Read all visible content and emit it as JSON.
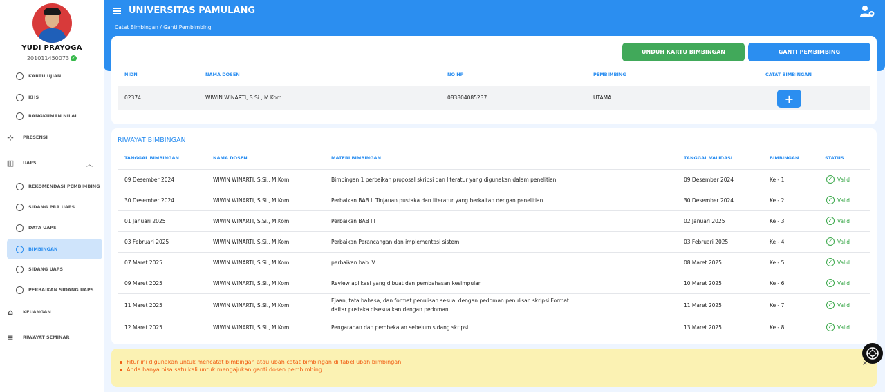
{
  "app": {
    "title": "UNIVERSITAS PAMULANG",
    "breadcrumb": "Catat Bimbingan / Ganti Pembimbing"
  },
  "user": {
    "name": "YUDI PRAYOGA",
    "nim": "201011450073"
  },
  "sidebar": {
    "items": [
      {
        "label": "KARTU UJIAN",
        "type": "sub"
      },
      {
        "label": "KHS",
        "type": "sub"
      },
      {
        "label": "RANGKUMAN NILAI",
        "type": "sub"
      },
      {
        "label": "PRESENSI",
        "type": "top",
        "icon": "fingerprint-icon"
      },
      {
        "label": "UAPS",
        "type": "top",
        "icon": "book-icon"
      },
      {
        "label": "REKOMENDASI PEMBIMBING",
        "type": "sub"
      },
      {
        "label": "SIDANG PRA UAPS",
        "type": "sub"
      },
      {
        "label": "DATA UAPS",
        "type": "sub"
      },
      {
        "label": "BIMBINGAN",
        "type": "sub",
        "active": true
      },
      {
        "label": "SIDANG UAPS",
        "type": "sub"
      },
      {
        "label": "PERBAIKAN SIDANG UAPS",
        "type": "sub"
      },
      {
        "label": "KEUANGAN",
        "type": "top",
        "icon": "bank-icon"
      },
      {
        "label": "RIWAYAT SEMINAR",
        "type": "top",
        "icon": "list-search-icon"
      }
    ]
  },
  "actions": {
    "download": "UNDUH KARTU BIMBINGAN",
    "change": "GANTI PEMBIMBING",
    "add": "+"
  },
  "advisor_table": {
    "headers": [
      "NIDN",
      "NAMA DOSEN",
      "NO HP",
      "PEMBIMBING",
      "CATAT BIMBINGAN"
    ],
    "row": {
      "nidn": "02374",
      "name": "WIWIN WINARTI, S.Si., M.Kom.",
      "phone": "083804085237",
      "role": "UTAMA"
    }
  },
  "history": {
    "title": "RIWAYAT BIMBINGAN",
    "headers": [
      "TANGGAL BIMBINGAN",
      "NAMA DOSEN",
      "MATERI BIMBINGAN",
      "TANGGAL VALIDASI",
      "BIMBINGAN",
      "STATUS"
    ],
    "rows": [
      {
        "date": "09 Desember 2024",
        "lecturer": "WIWIN WINARTI, S.Si., M.Kom.",
        "topic": "Bimbingan 1 perbaikan proposal skripsi dan literatur yang digunakan dalam penelitian",
        "topic2": "",
        "validated": "09 Desember 2024",
        "session": "Ke - 1",
        "status": "Valid"
      },
      {
        "date": "30 Desember 2024",
        "lecturer": "WIWIN WINARTI, S.Si., M.Kom.",
        "topic": "Perbaikan BAB II Tinjauan pustaka dan literatur yang berkaitan dengan penelitian",
        "topic2": "",
        "validated": "30 Desember 2024",
        "session": "Ke - 2",
        "status": "Valid"
      },
      {
        "date": "01 Januari 2025",
        "lecturer": "WIWIN WINARTI, S.Si., M.Kom.",
        "topic": "Perbaikan BAB III",
        "topic2": "",
        "validated": "02 Januari 2025",
        "session": "Ke - 3",
        "status": "Valid"
      },
      {
        "date": "03 Februari 2025",
        "lecturer": "WIWIN WINARTI, S.Si., M.Kom.",
        "topic": "Perbaikan Perancangan dan implementasi sistem",
        "topic2": "",
        "validated": "03 Februari 2025",
        "session": "Ke - 4",
        "status": "Valid"
      },
      {
        "date": "07 Maret 2025",
        "lecturer": "WIWIN WINARTI, S.Si., M.Kom.",
        "topic": "perbaikan bab IV",
        "topic2": "",
        "validated": "08 Maret 2025",
        "session": "Ke - 5",
        "status": "Valid"
      },
      {
        "date": "09 Maret 2025",
        "lecturer": "WIWIN WINARTI, S.Si., M.Kom.",
        "topic": "Review aplikasi yang dibuat dan pembahasan kesimpulan",
        "topic2": "",
        "validated": "10 Maret 2025",
        "session": "Ke - 6",
        "status": "Valid"
      },
      {
        "date": "11 Maret 2025",
        "lecturer": "WIWIN WINARTI, S.Si., M.Kom.",
        "topic": "Ejaan, tata bahasa, dan format penulisan sesuai dengan pedoman penulisan skripsi Format",
        "topic2": "daftar pustaka disesuaikan dengan pedoman",
        "validated": "11 Maret 2025",
        "session": "Ke - 7",
        "status": "Valid"
      },
      {
        "date": "12 Maret 2025",
        "lecturer": "WIWIN WINARTI, S.Si., M.Kom.",
        "topic": "Pengarahan dan pembekalan sebelum sidang skripsi",
        "topic2": "",
        "validated": "13 Maret 2025",
        "session": "Ke - 8",
        "status": "Valid"
      }
    ]
  },
  "notice": {
    "items": [
      "Fitur ini digunakan untuk mencatat bimbingan atau ubah catat bimbingan di tabel ubah bimbingan",
      "Anda hanya bisa satu kali untuk mengajukan ganti dosen pembimbing"
    ],
    "close": "×"
  },
  "colors": {
    "primary": "#2b8ef0",
    "success": "#41a95a",
    "valid": "#3aa84a",
    "notice_bg": "#fbf2b3",
    "notice_text": "#f05d12"
  }
}
